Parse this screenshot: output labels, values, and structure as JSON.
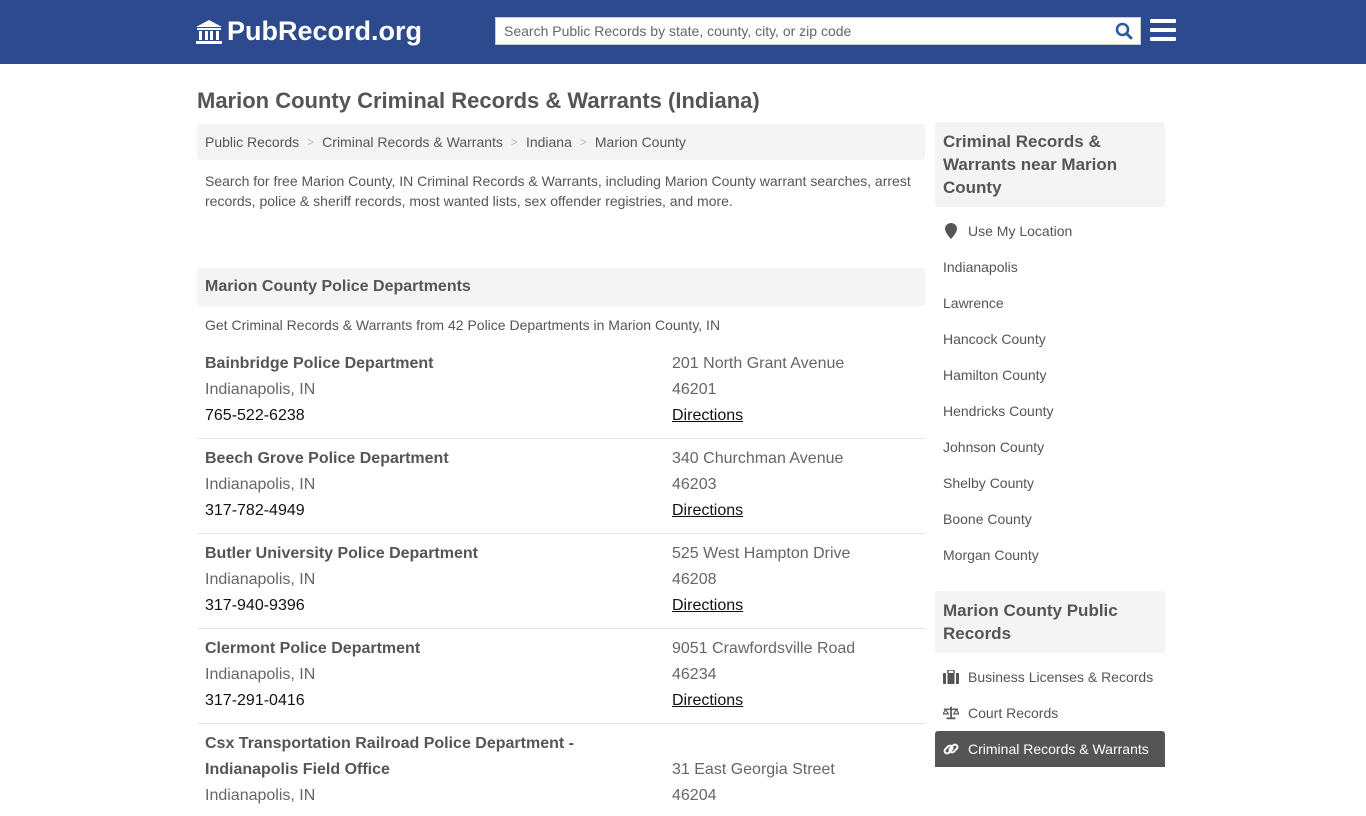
{
  "header": {
    "logo_text": "PubRecord.org",
    "search_placeholder": "Search Public Records by state, county, city, or zip code"
  },
  "page_title": "Marion County Criminal Records & Warrants (Indiana)",
  "breadcrumb": [
    "Public Records",
    "Criminal Records & Warrants",
    "Indiana",
    "Marion County"
  ],
  "intro": "Search for free Marion County, IN Criminal Records & Warrants, including Marion County warrant searches, arrest records, police & sheriff records, most wanted lists, sex offender registries, and more.",
  "section": {
    "title": "Marion County Police Departments",
    "subtitle": "Get Criminal Records & Warrants from 42 Police Departments in Marion County, IN"
  },
  "departments": [
    {
      "name": "Bainbridge Police Department",
      "city": "Indianapolis, IN",
      "phone": "765-522-6238",
      "address": "201 North Grant Avenue",
      "zip": "46201",
      "directions": "Directions"
    },
    {
      "name": "Beech Grove Police Department",
      "city": "Indianapolis, IN",
      "phone": "317-782-4949",
      "address": "340 Churchman Avenue",
      "zip": "46203",
      "directions": "Directions"
    },
    {
      "name": "Butler University Police Department",
      "city": "Indianapolis, IN",
      "phone": "317-940-9396",
      "address": "525 West Hampton Drive",
      "zip": "46208",
      "directions": "Directions"
    },
    {
      "name": "Clermont Police Department",
      "city": "Indianapolis, IN",
      "phone": "317-291-0416",
      "address": "9051 Crawfordsville Road",
      "zip": "46234",
      "directions": "Directions"
    },
    {
      "name_line1": "Csx Transportation Railroad Police Department -",
      "name_line2": "Indianapolis Field Office",
      "city": "Indianapolis, IN",
      "address": "31 East Georgia Street",
      "zip": "46204"
    }
  ],
  "sidebar": {
    "nearby_title": "Criminal Records & Warrants near Marion County",
    "use_location": "Use My Location",
    "nearby": [
      "Indianapolis",
      "Lawrence",
      "Hancock County",
      "Hamilton County",
      "Hendricks County",
      "Johnson County",
      "Shelby County",
      "Boone County",
      "Morgan County"
    ],
    "public_title": "Marion County Public Records",
    "public_links": [
      {
        "label": "Business Licenses & Records",
        "icon": "briefcase-icon"
      },
      {
        "label": "Court Records",
        "icon": "scales-icon"
      },
      {
        "label": "Criminal Records & Warrants",
        "icon": "link-icon",
        "active": true
      }
    ]
  }
}
